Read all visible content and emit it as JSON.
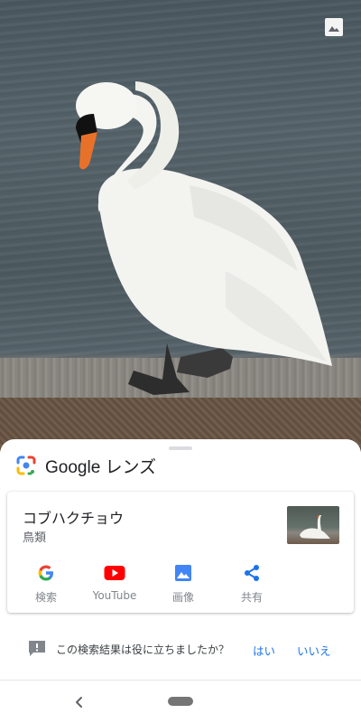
{
  "lens": {
    "title": "Google レンズ"
  },
  "result": {
    "name": "コブハクチョウ",
    "category": "鳥類"
  },
  "actions": [
    {
      "label": "検索",
      "icon": "google-g-icon"
    },
    {
      "label": "YouTube",
      "icon": "youtube-icon"
    },
    {
      "label": "画像",
      "icon": "image-icon"
    },
    {
      "label": "共有",
      "icon": "share-icon"
    }
  ],
  "feedback": {
    "question": "この検索結果は役に立ちましたか？",
    "yes": "はい",
    "no": "いいえ"
  },
  "colors": {
    "accent": "#1a73e8",
    "youtube": "#ff0000",
    "text": "#202124"
  }
}
